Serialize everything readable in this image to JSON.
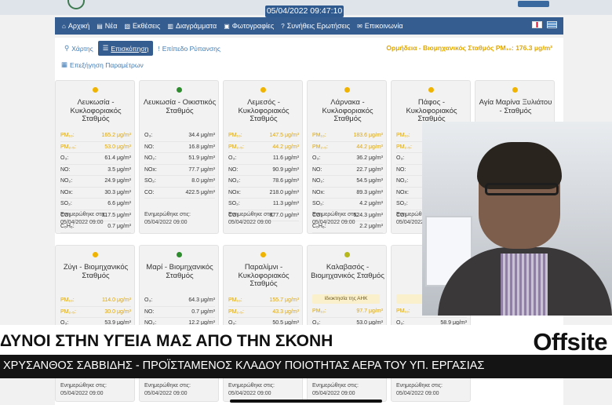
{
  "datetime": "05/04/2022 09:47:10",
  "nav": [
    {
      "icon": "home-icon",
      "glyph": "⌂",
      "label": "Αρχική"
    },
    {
      "icon": "news-icon",
      "glyph": "▤",
      "label": "Νέα"
    },
    {
      "icon": "reports-icon",
      "glyph": "▧",
      "label": "Εκθέσεις"
    },
    {
      "icon": "chart-icon",
      "glyph": "▥",
      "label": "Διαγράμματα"
    },
    {
      "icon": "photo-icon",
      "glyph": "▣",
      "label": "Φωτογραφίες"
    },
    {
      "icon": "question-icon",
      "glyph": "?",
      "label": "Συνήθεις Ερωτήσεις"
    },
    {
      "icon": "envelope-icon",
      "glyph": "✉",
      "label": "Επικοινωνία"
    }
  ],
  "tabs": {
    "map": "Χάρτης",
    "overview": "Επισκόπηση",
    "pollution": "Επίπεδο Ρύπανσης",
    "params": "Επεξήγηση Παραμέτρων"
  },
  "pollutant_summary": "Ορμήδεια - Βιομηχανικός Σταθμός PM₁₀: 176.3 μg/m³",
  "colors": {
    "yellow": "#f0b400",
    "green": "#2e8b2e",
    "olive": "#b7b81e",
    "warn_text": "#e0a600",
    "navy": "#365d8f"
  },
  "updated_label": "Ενημερώθηκε στις:",
  "stations_top": [
    {
      "name": "Λευκωσία - Κυκλοφοριακός Σταθμός",
      "status": "yellow",
      "rows": [
        [
          "PM₁₀:",
          "165.2 μg/m³",
          true
        ],
        [
          "PM₂.₅:",
          "53.0 μg/m³",
          true
        ],
        [
          "O₃:",
          "61.4 μg/m³",
          false
        ],
        [
          "NO:",
          "3.5 μg/m³",
          false
        ],
        [
          "NO₂:",
          "24.9 μg/m³",
          false
        ],
        [
          "NOx:",
          "30.3 μg/m³",
          false
        ],
        [
          "SO₂:",
          "6.6 μg/m³",
          false
        ],
        [
          "CO:",
          "317.5 μg/m³",
          false
        ],
        [
          "C₆H₆:",
          "0.7 μg/m³",
          false
        ]
      ],
      "updated": "05/04/2022 09:00"
    },
    {
      "name": "Λευκωσία - Οικιστικός Σταθμός",
      "status": "green",
      "rows": [
        [
          "O₃:",
          "34.4 μg/m³",
          false
        ],
        [
          "NO:",
          "16.8 μg/m³",
          false
        ],
        [
          "NO₂:",
          "51.9 μg/m³",
          false
        ],
        [
          "NOx:",
          "77.7 μg/m³",
          false
        ],
        [
          "SO₂:",
          "8.0 μg/m³",
          false
        ],
        [
          "CO:",
          "422.5 μg/m³",
          false
        ]
      ],
      "updated": "05/04/2022 09:00"
    },
    {
      "name": "Λεμεσός - Κυκλοφοριακός Σταθμός",
      "status": "yellow",
      "rows": [
        [
          "PM₁₀:",
          "147.5 μg/m³",
          true
        ],
        [
          "PM₂.₅:",
          "44.2 μg/m³",
          true
        ],
        [
          "O₃:",
          "11.6 μg/m³",
          false
        ],
        [
          "NO:",
          "90.9 μg/m³",
          false
        ],
        [
          "NO₂:",
          "78.6 μg/m³",
          false
        ],
        [
          "NOx:",
          "218.0 μg/m³",
          false
        ],
        [
          "SO₂:",
          "11.3 μg/m³",
          false
        ],
        [
          "CO:",
          "877.0 μg/m³",
          false
        ]
      ],
      "updated": "05/04/2022 09:00"
    },
    {
      "name": "Λάρνακα - Κυκλοφοριακός Σταθμός",
      "status": "yellow",
      "rows": [
        [
          "PM₁₀:",
          "183.6 μg/m³",
          true
        ],
        [
          "PM₂.₅:",
          "44.2 μg/m³",
          true
        ],
        [
          "O₃:",
          "36.2 μg/m³",
          false
        ],
        [
          "NO:",
          "22.7 μg/m³",
          false
        ],
        [
          "NO₂:",
          "54.5 μg/m³",
          false
        ],
        [
          "NOx:",
          "89.3 μg/m³",
          false
        ],
        [
          "SO₂:",
          "4.2 μg/m³",
          false
        ],
        [
          "CO:",
          "524.3 μg/m³",
          false
        ],
        [
          "C₆H₆:",
          "2.2 μg/m³",
          false
        ]
      ],
      "updated": "05/04/2022 09:00"
    },
    {
      "name": "Πάφος - Κυκλοφοριακός Σταθμός",
      "status": "yellow",
      "rows": [
        [
          "PM₁₀:",
          "",
          true
        ],
        [
          "PM₂.₅:",
          "",
          true
        ],
        [
          "O₃:",
          "",
          false
        ],
        [
          "NO:",
          "",
          false
        ],
        [
          "NO₂:",
          "",
          false
        ],
        [
          "NOx:",
          "",
          false
        ],
        [
          "SO₂:",
          "",
          false
        ],
        [
          "CO:",
          "",
          false
        ]
      ],
      "updated": "05/04/2022 09:00"
    },
    {
      "name": "Αγία Μαρίνα Ξυλιάτου - Σταθμός",
      "status": "yellow",
      "rows": [],
      "updated": ""
    }
  ],
  "stations_bottom": [
    {
      "name": "Ζύγι - Βιομηχανικός Σταθμός",
      "status": "yellow",
      "badge": "",
      "rows": [
        [
          "PM₁₀:",
          "114.0 μg/m³",
          true
        ],
        [
          "PM₂.₅:",
          "30.0 μg/m³",
          true
        ],
        [
          "O₃:",
          "53.9 μg/m³",
          false
        ]
      ],
      "updated": "05/04/2022 09:00"
    },
    {
      "name": "Μαρί - Βιομηχανικός Σταθμός",
      "status": "green",
      "badge": "",
      "rows": [
        [
          "O₃:",
          "64.3 μg/m³",
          false
        ],
        [
          "NO:",
          "0.7 μg/m³",
          false
        ],
        [
          "NO₂:",
          "12.2 μg/m³",
          false
        ]
      ],
      "updated": "05/04/2022 09:00"
    },
    {
      "name": "Παραλίμνι - Κυκλοφοριακός Σταθμός",
      "status": "yellow",
      "badge": "",
      "rows": [
        [
          "PM₁₀:",
          "155.7 μg/m³",
          true
        ],
        [
          "PM₂.₅:",
          "43.3 μg/m³",
          true
        ],
        [
          "O₃:",
          "50.5 μg/m³",
          false
        ]
      ],
      "updated": "05/04/2022 09:00"
    },
    {
      "name": "Καλαβασός - Βιομηχανικός Σταθμός",
      "status": "olive",
      "badge": "Ιδιοκτησία της ΑΗΚ",
      "rows": [
        [
          "PM₁₀:",
          "97.7 μg/m³",
          true
        ],
        [
          "O₃:",
          "53.0 μg/m³",
          false
        ]
      ],
      "updated": "05/04/2022 09:00"
    },
    {
      "name": "Ορ",
      "status": "yellow",
      "badge": "Ιδιοκ",
      "rows": [
        [
          "PM₁₀:",
          "",
          true
        ],
        [
          "O₃:",
          "58.9 μg/m³",
          false
        ]
      ],
      "updated": "05/04/2022 09:00"
    }
  ],
  "ticker": "ΔΥΝΟΙ ΣΤΗΝ ΥΓΕΙΑ ΜΑΣ ΑΠΟ ΤΗΝ ΣΚΟΝΗ",
  "brand": "Offsite",
  "lower_third": "ΧΡΥΣΑΝΘΟΣ ΣΑΒΒΙΔΗΣ - ΠΡΟΪΣΤΑΜΕΝΟΣ ΚΛΑΔΟΥ ΠΟΙΟΤΗΤΑΣ ΑΕΡΑ ΤΟΥ ΥΠ. ΕΡΓΑΣΙΑΣ"
}
